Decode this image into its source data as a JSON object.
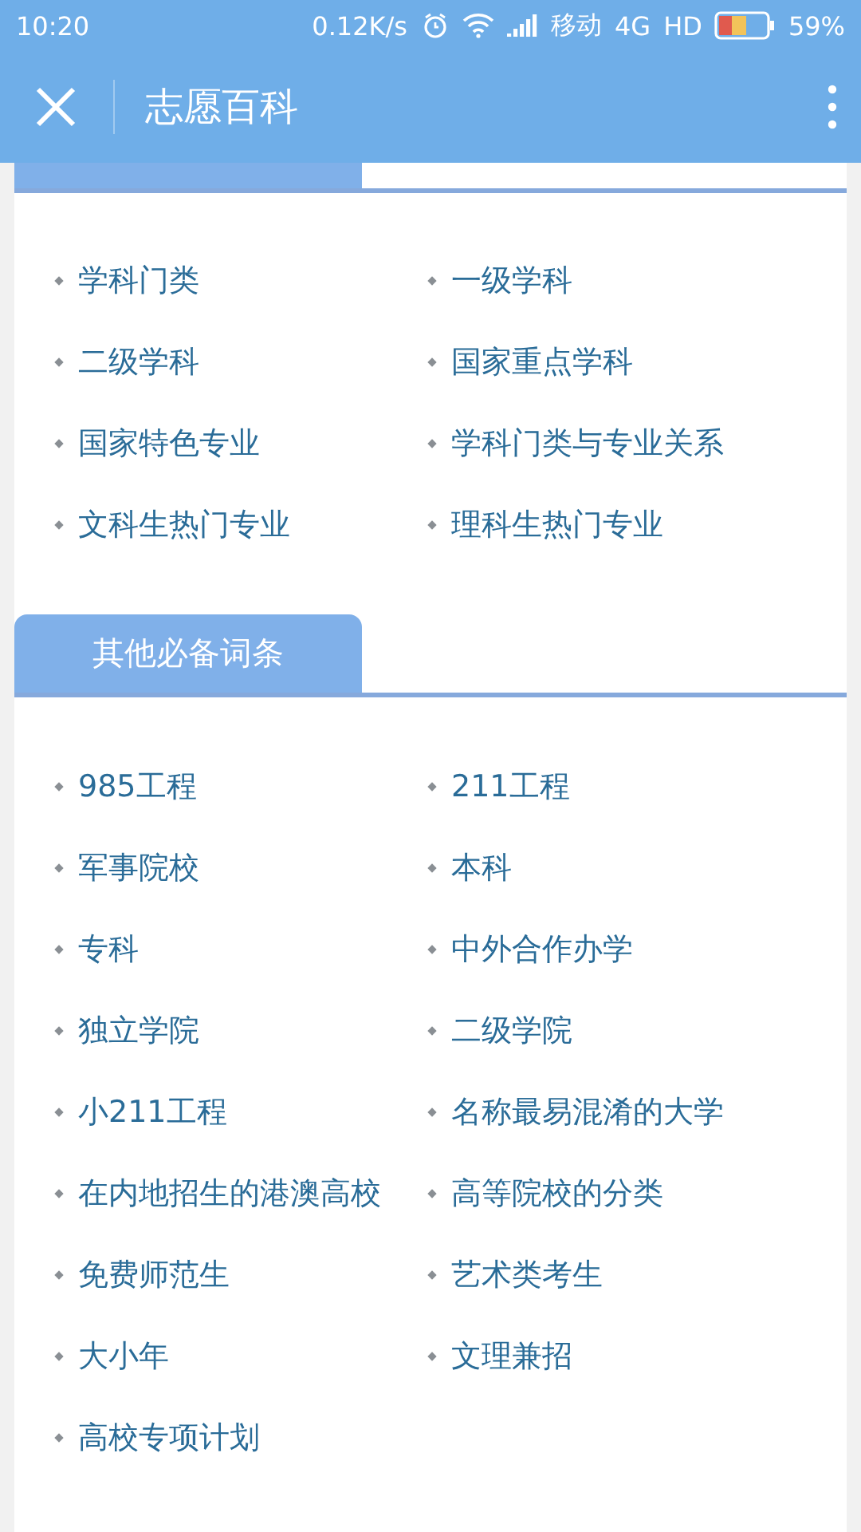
{
  "status_bar": {
    "time": "10:20",
    "speed": "0.12K/s",
    "carrier": "移动",
    "network": "4G",
    "hd": "HD",
    "battery": "59%"
  },
  "header": {
    "title": "志愿百科"
  },
  "sections": [
    {
      "items": [
        "学科门类",
        "一级学科",
        "二级学科",
        "国家重点学科",
        "国家特色专业",
        "学科门类与专业关系",
        "文科生热门专业",
        "理科生热门专业"
      ]
    },
    {
      "title": "其他必备词条",
      "items": [
        "985工程",
        "211工程",
        "军事院校",
        "本科",
        "专科",
        "中外合作办学",
        "独立学院",
        "二级学院",
        "小211工程",
        "名称最易混淆的大学",
        "在内地招生的港澳高校",
        "高等院校的分类",
        "免费师范生",
        "艺术类考生",
        "大小年",
        "文理兼招",
        "高校专项计划"
      ]
    }
  ]
}
